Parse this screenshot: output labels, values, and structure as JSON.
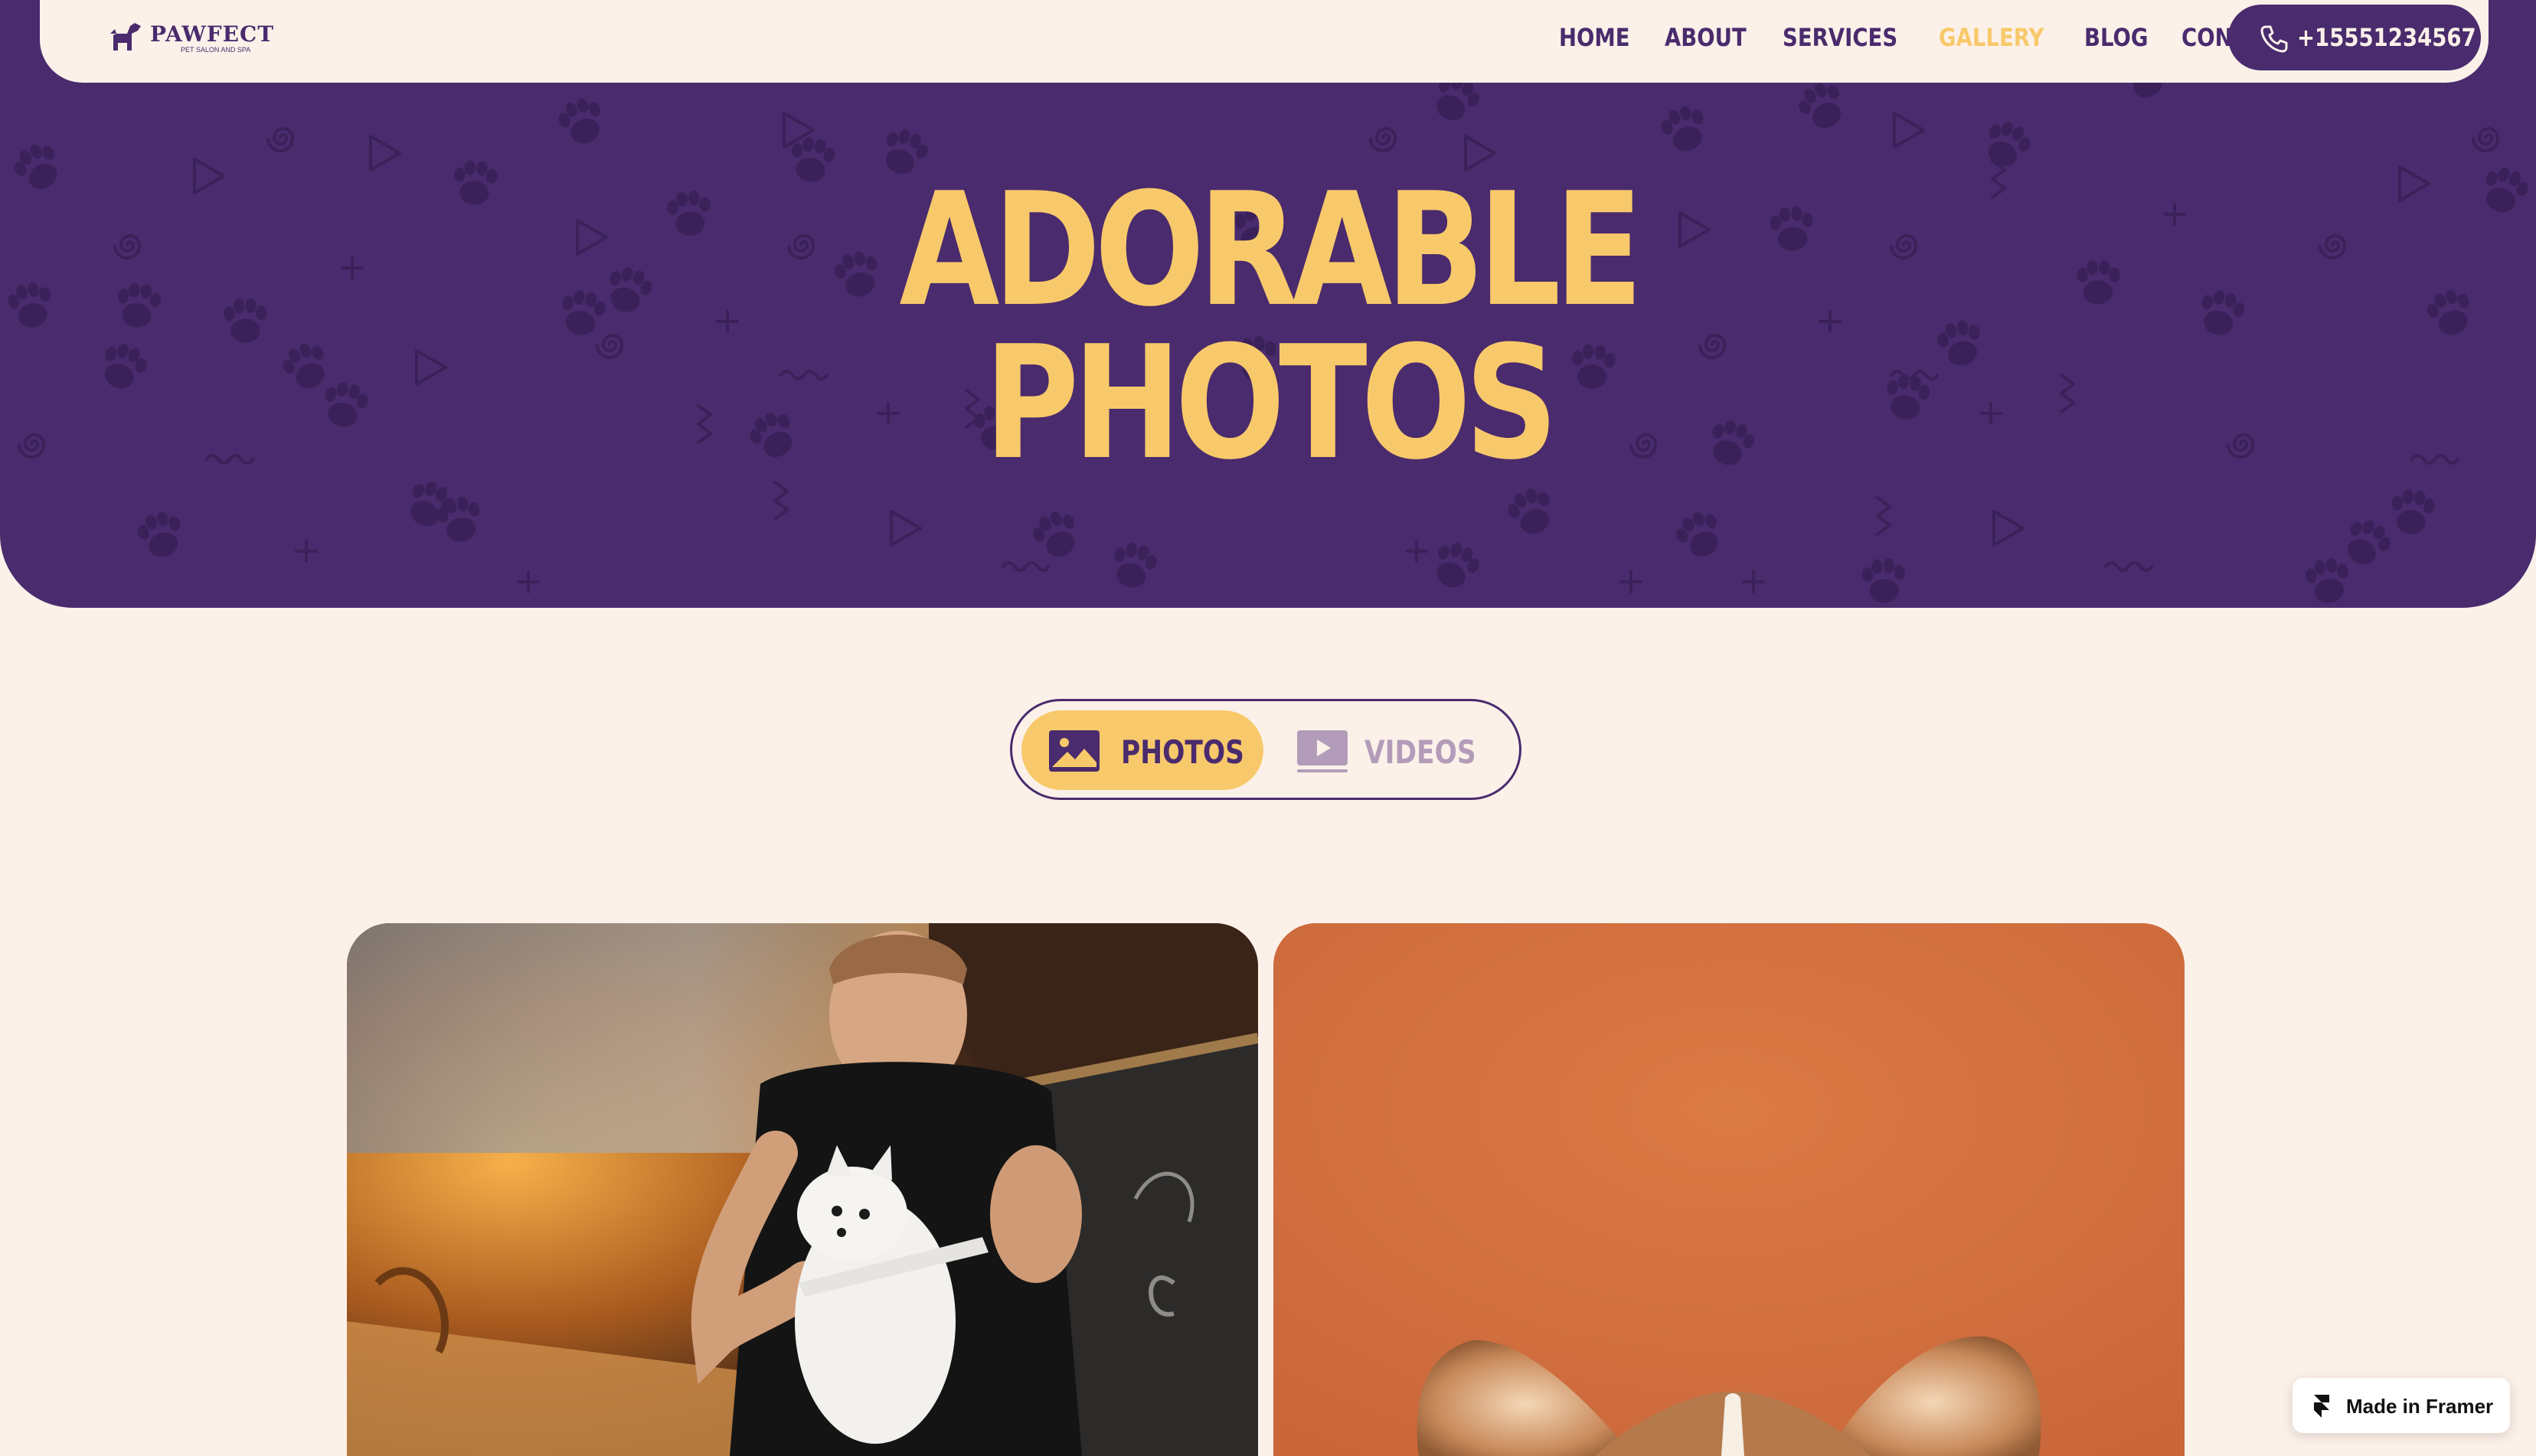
{
  "colors": {
    "brand_purple": "#4A2B6D",
    "accent_yellow": "#F8C96A",
    "page_cream": "#FCF1E9",
    "muted_lilac": "#B39CB9"
  },
  "logo": {
    "name": "PAWFECT",
    "tagline": "PET SALON AND SPA",
    "icon": "dog-icon"
  },
  "nav": {
    "links": [
      {
        "label": "HOME",
        "active": false
      },
      {
        "label": "ABOUT",
        "active": false
      },
      {
        "label": "SERVICES",
        "active": false
      },
      {
        "label": "GALLERY",
        "active": true
      },
      {
        "label": "BLOG",
        "active": false
      },
      {
        "label": "CONTACT",
        "active": false
      }
    ],
    "phone": {
      "label": "+15551234567",
      "icon": "phone-icon"
    }
  },
  "hero": {
    "title_line1": "ADORABLE",
    "title_line2": "PHOTOS",
    "background_pattern": "paw-prints-pattern"
  },
  "media_toggle": {
    "options": [
      {
        "label": "PHOTOS",
        "icon": "image-icon",
        "selected": true
      },
      {
        "label": "VIDEOS",
        "icon": "video-icon",
        "selected": false
      }
    ]
  },
  "gallery": [
    {
      "subject": "groomer-combing-white-spitz"
    },
    {
      "subject": "corgi-on-orange-background"
    }
  ],
  "badge": {
    "label": "Made in Framer",
    "icon": "framer-icon"
  }
}
